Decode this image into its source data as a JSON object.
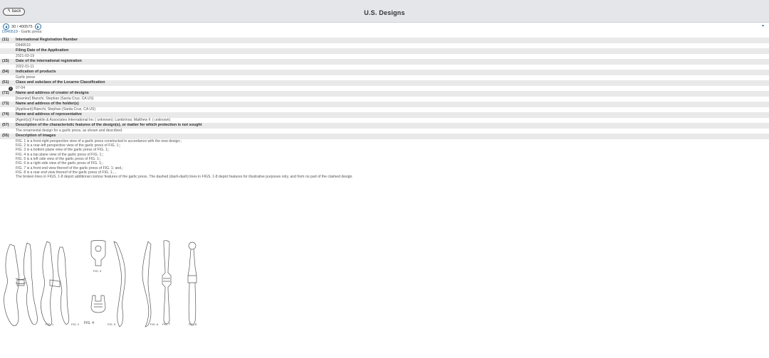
{
  "header": {
    "back_label": "↰ back",
    "title": "U.S. Designs"
  },
  "nav": {
    "position": "30 / 400575"
  },
  "doc": {
    "number": "D940519",
    "title": " - Garlic press"
  },
  "sections": [
    {
      "code": "(11)",
      "label": "International Registration Number",
      "values": [
        "D940519"
      ]
    },
    {
      "code": "",
      "label": "Filing Date of the Application",
      "values": [
        "2021-03-19"
      ]
    },
    {
      "code": "(15)",
      "label": "Date of the international registration",
      "values": [
        "2022-01-11"
      ]
    },
    {
      "code": "(54)",
      "label": "Indication of products",
      "values": [
        "Garlic press"
      ]
    },
    {
      "code": "(51)",
      "label": "Class and subclass of the Locarno Classification",
      "values": [
        "07-04"
      ]
    },
    {
      "code": "(72)",
      "label": "Name and address of creator of designs",
      "values": [
        "[Inventor] Bianchi, Stephan (Santa Cruz, CA US)"
      ]
    },
    {
      "code": "(73)",
      "label": "Name and address of the holder(s)",
      "values": [
        "[Applicant]  Bianchi, Stephan (Santa Cruz, CA US)"
      ]
    },
    {
      "code": "(74)",
      "label": "Name and address of representative",
      "values": [
        "[Agent(s)] Franklin & Associates International Inc ( unknown); Lambrinos; Matthew F. ( unknown)"
      ]
    },
    {
      "code": "(57)",
      "label": "Description of the characteristic features of the design(s), or matter for which protection is not sought",
      "values": [
        "The ornamental design for a garlic press, as shown and described."
      ]
    },
    {
      "code": "(55)",
      "label": "Description of images",
      "values": [
        "FIG. 1 is a front-right perspective view of a garlic press constructed in accordance with the new design;;",
        "FIG. 2 is a rear-left perspective view of the garlic press of FIG. 1;;",
        "FIG. 3 is a bottom plane view of the garlic press of FIG. 1;;",
        "FIG. 4 is a top plane view of the garlic press of FIG. 1;;",
        "FIG. 5 is a left side view of the garlic press of FIG. 1;;",
        "FIG. 6 is a right side view of the garlic press of FIG. 1;;",
        "FIG. 7 is a front end view thereof of the garlic press of FIG. 1; and,;",
        "FIG. 8 is a rear end view thereof of the garlic press of FIG. 1....",
        "The broken lines in FIGS. 1-8 depict additional contour features of the garlic press. The dashed (dash-dash) lines in FIGS. 1-8 depict features for illustrative purposes only, and form no part of the claimed design."
      ]
    }
  ],
  "figures": [
    "FIG. 1",
    "FIG. 2",
    "FIG. 3",
    "FIG. 4",
    "FIG. 5",
    "FIG. 6",
    "FIG. 7",
    "FIG. 8"
  ],
  "colors": {
    "link": "#2d6da3",
    "header_bg": "#e4e6ea",
    "section_bg": "#e9e9e9"
  }
}
